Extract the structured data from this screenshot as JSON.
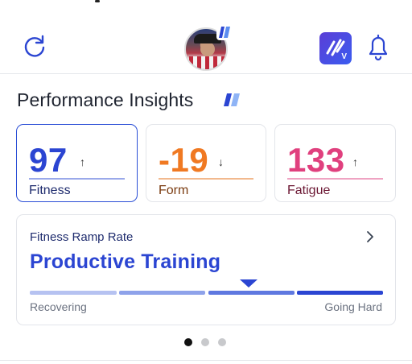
{
  "header": {
    "refresh_icon": "refresh-icon",
    "avatar_badge_icon": "brand-mark-icon",
    "app_icon": "app-logo-icon",
    "app_icon_letter": "V",
    "bell_icon": "bell-icon"
  },
  "insights": {
    "title": "Performance Insights",
    "title_icon": "brand-mark-icon"
  },
  "metrics": [
    {
      "value": "97",
      "label": "Fitness",
      "trend": "↑",
      "color": "#2b45d2",
      "selected": true
    },
    {
      "value": "-19",
      "label": "Form",
      "trend": "↓",
      "color": "#f07922",
      "selected": false
    },
    {
      "value": "133",
      "label": "Fatigue",
      "trend": "↑",
      "color": "#e0407e",
      "selected": false
    }
  ],
  "ramp": {
    "heading": "Fitness Ramp Rate",
    "status": "Productive Training",
    "low_label": "Recovering",
    "high_label": "Going Hard",
    "marker_position": 0.62,
    "segment_colors": [
      "#b6c2f1",
      "#8ea2ea",
      "#5f78e0",
      "#2b45d2"
    ]
  },
  "pagination": {
    "pages": 3,
    "active": 1
  }
}
